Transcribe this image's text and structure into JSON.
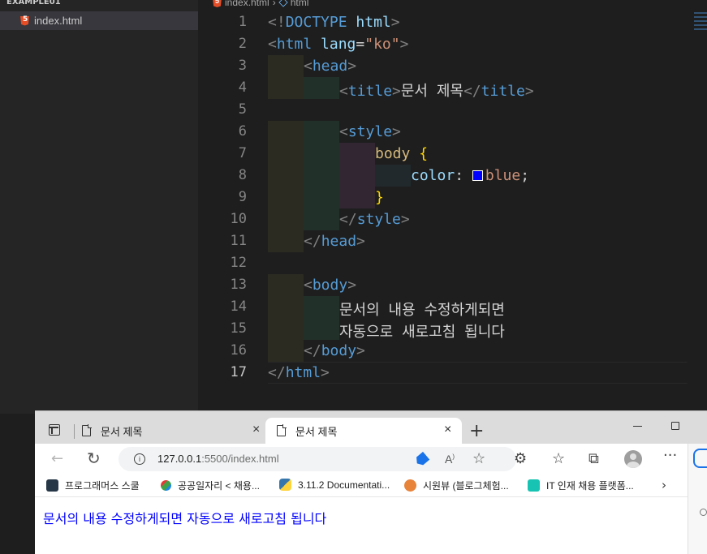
{
  "vscode": {
    "explorer": {
      "section_title": "EXAMPLE01",
      "file_name": "index.html"
    },
    "breadcrumb": {
      "file": "index.html",
      "symbol": "html"
    },
    "lines": [
      {
        "n": "1",
        "parts": [
          [
            "t-brk",
            "<!"
          ],
          [
            "t-tag",
            "DOCTYPE"
          ],
          [
            "t-txt",
            " "
          ],
          [
            "t-att",
            "html"
          ],
          [
            "t-brk",
            ">"
          ]
        ]
      },
      {
        "n": "2",
        "parts": [
          [
            "t-brk",
            "<"
          ],
          [
            "t-tag",
            "html"
          ],
          [
            "t-txt",
            " "
          ],
          [
            "t-att",
            "lang"
          ],
          [
            "t-txt",
            "="
          ],
          [
            "t-str",
            "\"ko\""
          ],
          [
            "t-brk",
            ">"
          ]
        ]
      },
      {
        "n": "3",
        "indent": 1,
        "parts": [
          [
            "t-brk",
            "<"
          ],
          [
            "t-tag",
            "head"
          ],
          [
            "t-brk",
            ">"
          ]
        ]
      },
      {
        "n": "4",
        "indent": 2,
        "parts": [
          [
            "t-brk",
            "<"
          ],
          [
            "t-tag",
            "title"
          ],
          [
            "t-brk",
            ">"
          ],
          [
            "t-txt",
            "문서 제목"
          ],
          [
            "t-brk",
            "</"
          ],
          [
            "t-tag",
            "title"
          ],
          [
            "t-brk",
            ">"
          ]
        ]
      },
      {
        "n": "5",
        "parts": []
      },
      {
        "n": "6",
        "indent": 2,
        "parts": [
          [
            "t-brk",
            "<"
          ],
          [
            "t-tag",
            "style"
          ],
          [
            "t-brk",
            ">"
          ]
        ]
      },
      {
        "n": "7",
        "indent": 3,
        "parts": [
          [
            "t-sel",
            "body"
          ],
          [
            "t-txt",
            " "
          ],
          [
            "t-brace",
            "{"
          ]
        ]
      },
      {
        "n": "8",
        "indent": 4,
        "swatch": true,
        "parts": [
          [
            "t-prop",
            "color"
          ],
          [
            "t-txt",
            ": "
          ],
          [
            "swatch",
            ""
          ],
          [
            "t-val",
            "blue"
          ],
          [
            "t-txt",
            ";"
          ]
        ]
      },
      {
        "n": "9",
        "indent": 3,
        "parts": [
          [
            "t-brace",
            "}"
          ]
        ]
      },
      {
        "n": "10",
        "indent": 2,
        "parts": [
          [
            "t-brk",
            "</"
          ],
          [
            "t-tag",
            "style"
          ],
          [
            "t-brk",
            ">"
          ]
        ]
      },
      {
        "n": "11",
        "indent": 1,
        "parts": [
          [
            "t-brk",
            "</"
          ],
          [
            "t-tag",
            "head"
          ],
          [
            "t-brk",
            ">"
          ]
        ]
      },
      {
        "n": "12",
        "parts": []
      },
      {
        "n": "13",
        "indent": 1,
        "parts": [
          [
            "t-brk",
            "<"
          ],
          [
            "t-tag",
            "body"
          ],
          [
            "t-brk",
            ">"
          ]
        ]
      },
      {
        "n": "14",
        "indent": 2,
        "parts": [
          [
            "t-txt",
            "문서의 내용 수정하게되면"
          ]
        ]
      },
      {
        "n": "15",
        "indent": 2,
        "parts": [
          [
            "t-txt",
            "자동으로 새로고침 됩니다"
          ]
        ]
      },
      {
        "n": "16",
        "indent": 1,
        "parts": [
          [
            "t-brk",
            "</"
          ],
          [
            "t-tag",
            "body"
          ],
          [
            "t-brk",
            ">"
          ]
        ]
      },
      {
        "n": "17",
        "active": true,
        "parts": [
          [
            "t-brk",
            "</"
          ],
          [
            "t-tag",
            "html"
          ],
          [
            "t-brk",
            ">"
          ]
        ]
      }
    ],
    "colors": {
      "swatch": "#0000ff"
    }
  },
  "browser": {
    "tabs": [
      {
        "title": "문서 제목",
        "active": false
      },
      {
        "title": "문서 제목",
        "active": true
      }
    ],
    "new_tab": "+",
    "url_host": "127.0.0.1",
    "url_rest": ":5500/index.html",
    "bookmarks": [
      "프로그래머스 스쿨",
      "공공일자리 < 채용...",
      "3.11.2 Documentati...",
      "시원뷰 (블로그체험...",
      "IT 인재 채용 플랫폼..."
    ],
    "page_text": "문서의 내용 수정하게되면 자동으로 새로고침 됩니다",
    "page_text_color": "#0000ff"
  }
}
